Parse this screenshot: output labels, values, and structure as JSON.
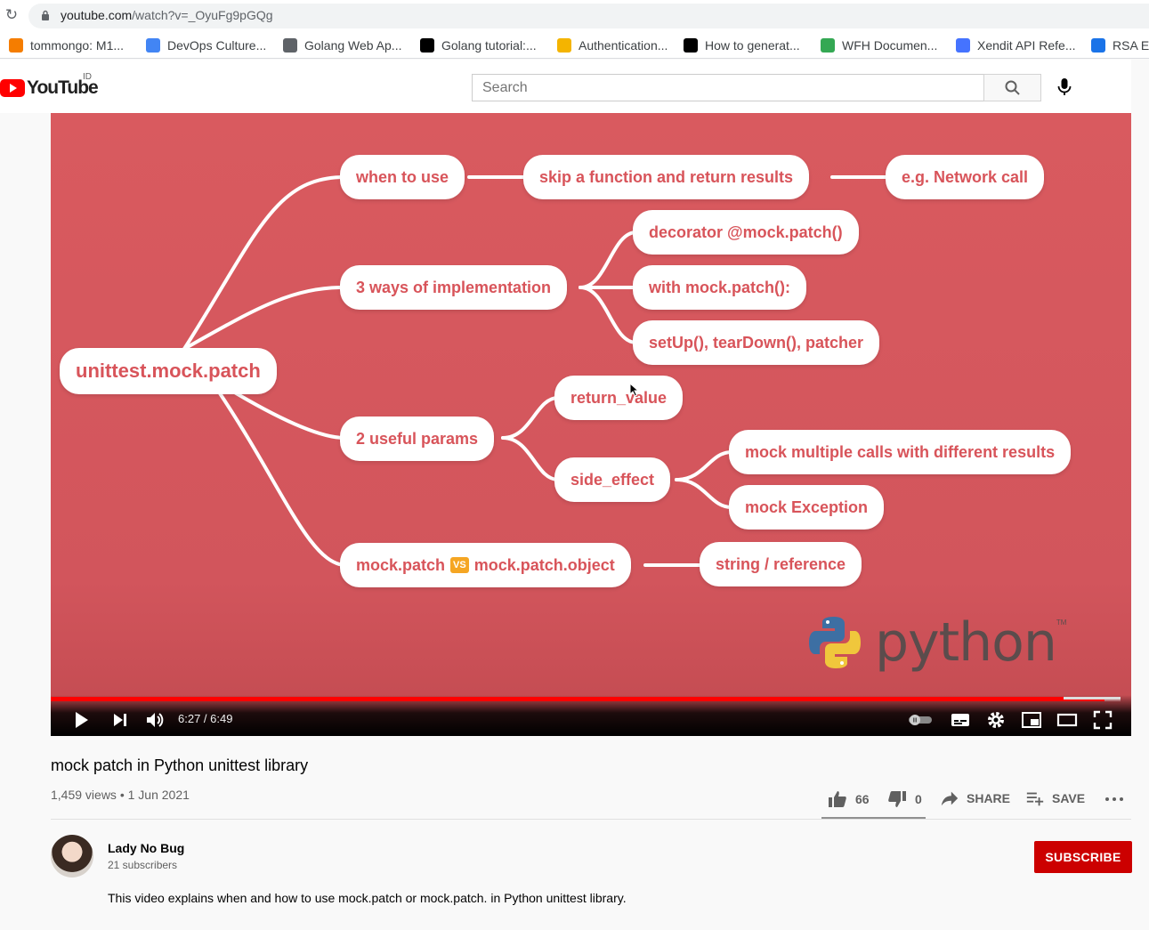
{
  "browser": {
    "url_main": "youtube.com",
    "url_path": "/watch?v=_OyuFg9pGQg",
    "bookmarks": [
      {
        "label": "tommongo: M1...",
        "icon": "blogger-icon",
        "color": "#f57d00"
      },
      {
        "label": "DevOps Culture...",
        "icon": "infinity-icon",
        "color": "#4285f4"
      },
      {
        "label": "Golang Web Ap...",
        "icon": "book-icon",
        "color": "#5f6368"
      },
      {
        "label": "Golang tutorial:...",
        "icon": "gb-icon",
        "color": "#000000"
      },
      {
        "label": "Authentication...",
        "icon": "key-icon",
        "color": "#f4b400"
      },
      {
        "label": "How to generat...",
        "icon": "medium-icon",
        "color": "#000000"
      },
      {
        "label": "WFH Documen...",
        "icon": "drive-icon",
        "color": "#34a853"
      },
      {
        "label": "Xendit API Refe...",
        "icon": "xendit-icon",
        "color": "#4573ff"
      },
      {
        "label": "RSA En",
        "icon": "rsa-icon",
        "color": "#1a73e8"
      }
    ]
  },
  "youtube": {
    "logo_text": "YouTube",
    "country": "ID",
    "search_placeholder": "Search"
  },
  "mindmap": {
    "root": "unittest.mock.patch",
    "when_to_use": "when to use",
    "skip": "skip a function and return results",
    "network": "e.g. Network call",
    "three_ways": "3 ways of implementation",
    "decorator": "decorator @mock.patch()",
    "with": "with mock.patch():",
    "setup": "setUp(), tearDown(), patcher",
    "two_params": "2 useful params",
    "return_value": "return_value",
    "side_effect": "side_effect",
    "multi_calls": "mock multiple calls with different results",
    "mock_exception": "mock Exception",
    "patch_a": "mock.patch",
    "vs": "VS",
    "patch_b": "mock.patch.object",
    "string_ref": "string / reference",
    "python": "python",
    "tm": "TM"
  },
  "player": {
    "time": "6:27 / 6:49",
    "progress": 0.985
  },
  "video": {
    "title": "mock patch in Python unittest library",
    "meta": "1,459 views • 1 Jun 2021",
    "likes": "66",
    "dislikes": "0",
    "share": "SHARE",
    "save": "SAVE"
  },
  "channel": {
    "name": "Lady No Bug",
    "subscribers": "21 subscribers",
    "subscribe": "SUBSCRIBE",
    "description": "This video explains when and how to use mock.patch or mock.patch. in Python unittest library."
  },
  "colors": {
    "accent_red": "#cc0000",
    "video_bg": "#d95a5f",
    "node_text": "#d8545a"
  }
}
